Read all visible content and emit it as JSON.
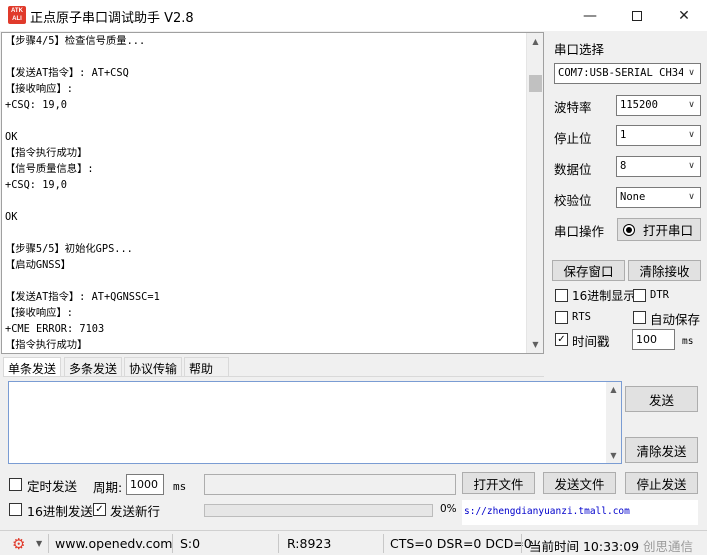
{
  "window": {
    "logo_text": "ATK ALIENTEK",
    "title": "正点原子串口调试助手 V2.8",
    "minimize_icon": "minimize-icon",
    "maximize_icon": "maximize-icon",
    "close_icon": "close-icon"
  },
  "receive": {
    "lines": [
      "【步骤4/5】检查信号质量...",
      "",
      "【发送AT指令】: AT+CSQ",
      "【接收响应】:",
      "+CSQ: 19,0",
      "",
      "OK",
      "【指令执行成功】",
      "【信号质量信息】:",
      "+CSQ: 19,0",
      "",
      "OK",
      "",
      "【步骤5/5】初始化GPS...",
      "【启动GNSS】",
      "",
      "【发送AT指令】: AT+QGNSSC=1",
      "【接收响应】:",
      "+CME ERROR: 7103",
      "【指令执行成功】"
    ]
  },
  "serial": {
    "section_title": "串口选择",
    "port_value": "COM7:USB-SERIAL CH340",
    "baud_label": "波特率",
    "baud_value": "115200",
    "stopbit_label": "停止位",
    "stopbit_value": "1",
    "databit_label": "数据位",
    "databit_value": "8",
    "parity_label": "校验位",
    "parity_value": "None",
    "operation_label": "串口操作",
    "open_button": "打开串口",
    "save_window": "保存窗口",
    "clear_receive": "清除接收",
    "hex_display": "16进制显示",
    "dtr": "DTR",
    "rts": "RTS",
    "auto_save": "自动保存",
    "timestamp": "时间戳",
    "timestamp_checked": true,
    "timestamp_value": "100",
    "timestamp_unit": "ms"
  },
  "tabs": [
    "单条发送",
    "多条发送",
    "协议传输",
    "帮助"
  ],
  "send": {
    "send_button": "发送",
    "clear_send": "清除发送",
    "timed_send": "定时发送",
    "period_label": "周期:",
    "period_value": "1000",
    "period_unit": "ms",
    "open_file": "打开文件",
    "send_file": "发送文件",
    "stop_send": "停止发送",
    "hex_send": "16进制发送",
    "send_newline": "发送新行",
    "send_newline_checked": true,
    "progress_text": "0%",
    "progress": 0,
    "link_text": "s://zhengdianyuanzi.tmall.com"
  },
  "status": {
    "website": "www.openedv.com",
    "sent": "S:0",
    "received": "R:8923",
    "signals": "CTS=0 DSR=0 DCD=0",
    "time": "当前时间 10:33:09",
    "watermark": "创思通信"
  },
  "colors": {
    "accent": "#e03a2b",
    "send_border": "#7a9cd3"
  }
}
